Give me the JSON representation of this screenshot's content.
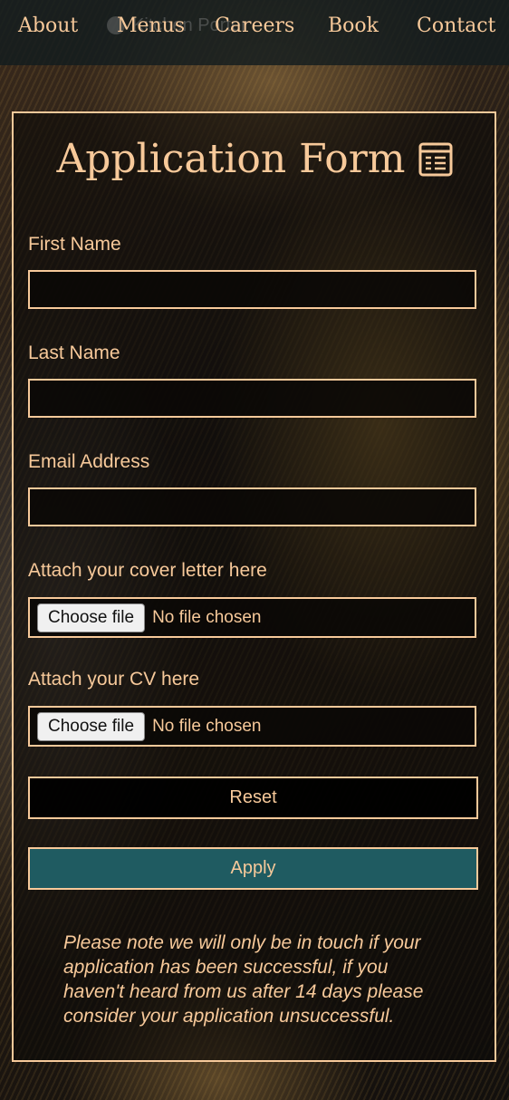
{
  "nav": {
    "ghost_title": "Kitchen Porter",
    "links": [
      "About",
      "Menus",
      "Careers",
      "Book",
      "Contact"
    ]
  },
  "form": {
    "title": "Application Form",
    "title_icon": "form-list-icon",
    "first_name_label": "First Name",
    "first_name_value": "",
    "last_name_label": "Last Name",
    "last_name_value": "",
    "email_label": "Email Address",
    "email_value": "",
    "cover_letter_label": "Attach your cover letter here",
    "cv_label": "Attach your CV here",
    "choose_file_label": "Choose file",
    "no_file_text": "No file chosen",
    "reset_label": "Reset",
    "apply_label": "Apply",
    "note": "Please note we will only be in touch if your application has been successful, if you haven't heard from us after 14 days please consider your application unsuccessful."
  },
  "colors": {
    "accent": "#f7c99a",
    "apply_bg": "#1f5b61",
    "nav_bg": "#121c1e"
  }
}
